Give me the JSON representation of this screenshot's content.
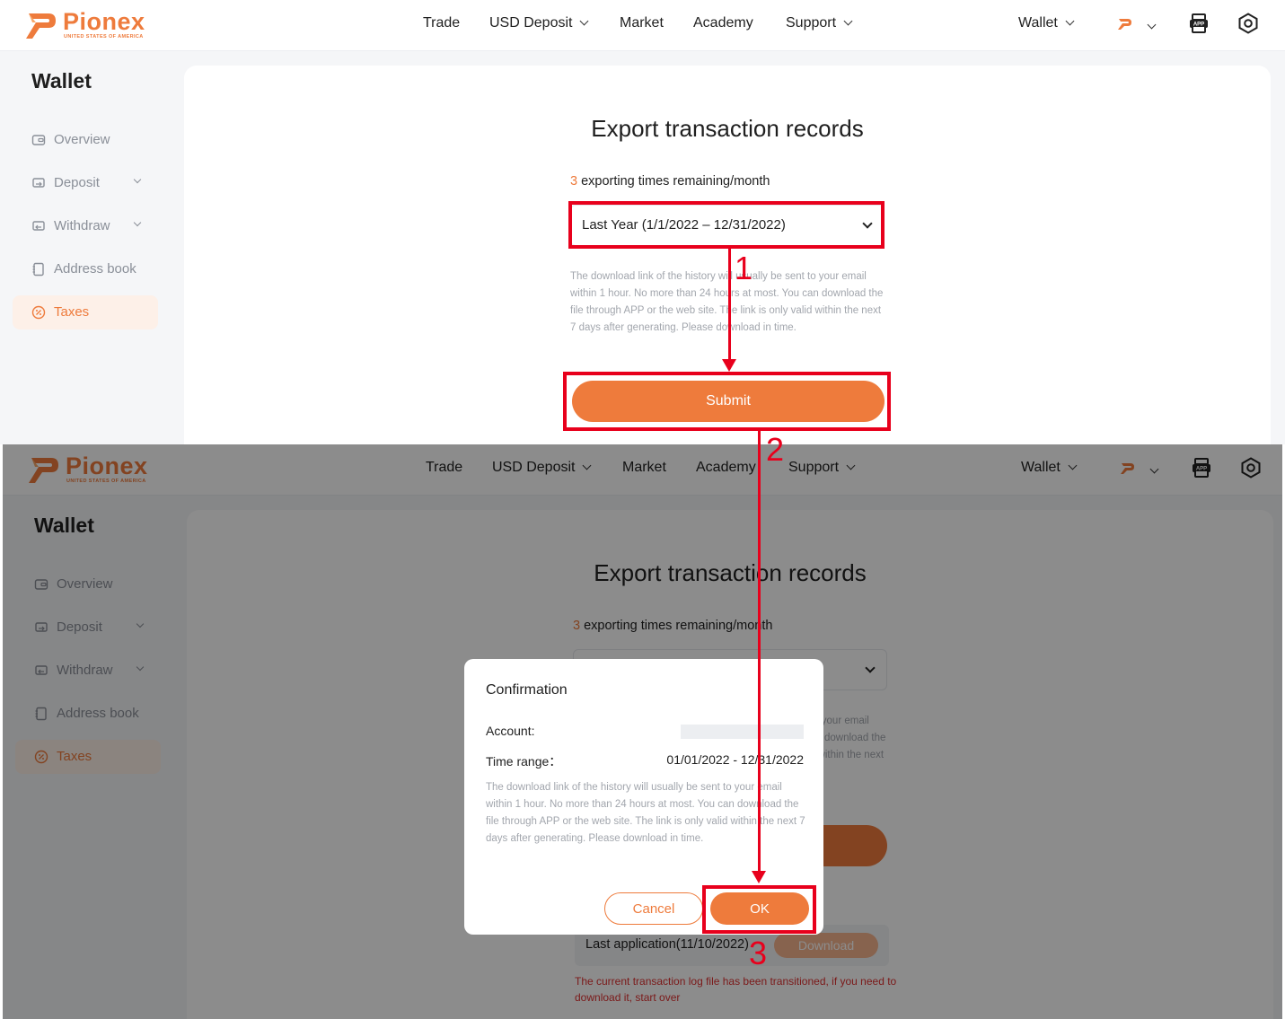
{
  "brand": {
    "name": "Pionex",
    "subtitle": "UNITED STATES OF AMERICA",
    "color": "#ee7b3c"
  },
  "topnav": {
    "items": [
      "Trade",
      "USD Deposit",
      "Market",
      "Academy",
      "Support"
    ],
    "wallet": "Wallet",
    "icons": [
      "pionex-logo-icon",
      "app-download-icon",
      "settings-icon"
    ]
  },
  "sidebar": {
    "title": "Wallet",
    "items": [
      {
        "label": "Overview",
        "icon": "wallet-icon"
      },
      {
        "label": "Deposit",
        "icon": "deposit-icon"
      },
      {
        "label": "Withdraw",
        "icon": "withdraw-icon"
      },
      {
        "label": "Address book",
        "icon": "address-book-icon"
      },
      {
        "label": "Taxes",
        "icon": "taxes-icon",
        "active": true
      }
    ]
  },
  "export": {
    "title": "Export transaction records",
    "remaining_count": "3",
    "remaining_text": "exporting times remaining/month",
    "range_selected": "Last Year (1/1/2022 – 12/31/2022)",
    "note": "The download link of the history will usually be sent to your email within 1 hour. No more than 24 hours at most. You can download the file through APP or the web site. The link is only valid within the next 7 days after generating. Please download in time.",
    "submit_label": "Submit",
    "last_application": "Last application(11/10/2022)",
    "download_label": "Download",
    "transitioned_msg": "The current transaction log file has been transitioned, if you need to download it, start over"
  },
  "confirmation": {
    "title": "Confirmation",
    "account_label": "Account:",
    "time_range_label": "Time range：",
    "time_range_value": "01/01/2022 - 12/31/2022",
    "note": "The download link of the history will usually be sent to your email within 1 hour. No more than 24 hours at most. You can download the file through APP or the web site. The link is only valid within the next 7 days after generating. Please download in time.",
    "cancel_label": "Cancel",
    "ok_label": "OK"
  },
  "annotations": {
    "steps": [
      "1",
      "2",
      "3"
    ],
    "color": "#e8001c"
  }
}
